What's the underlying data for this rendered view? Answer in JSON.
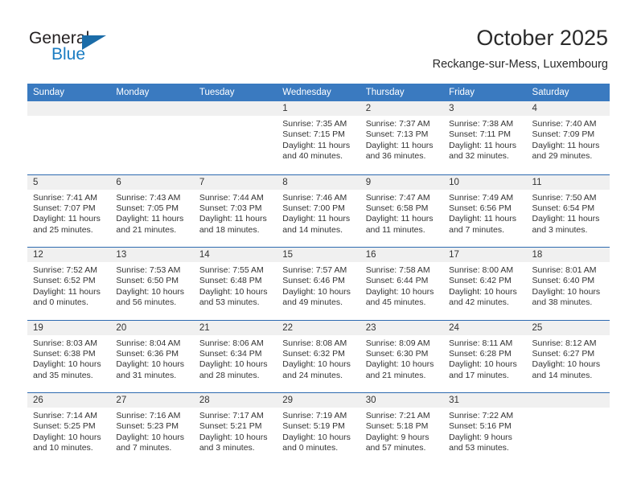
{
  "logo": {
    "word_one": "General",
    "word_two": "Blue",
    "triangle_icon": "triangle-icon",
    "brand_blue": "#1a7cc2",
    "brand_dark": "#231f20"
  },
  "header": {
    "title": "October 2025",
    "subtitle": "Reckange-sur-Mess, Luxembourg",
    "header_bg": "#3a7ac0",
    "row_line": "#2d6ab0",
    "day_band_bg": "#f0f0f0"
  },
  "weekdays": [
    "Sunday",
    "Monday",
    "Tuesday",
    "Wednesday",
    "Thursday",
    "Friday",
    "Saturday"
  ],
  "weeks": [
    [
      {
        "day": "",
        "sunrise": "",
        "sunset": "",
        "daylight_1": "",
        "daylight_2": ""
      },
      {
        "day": "",
        "sunrise": "",
        "sunset": "",
        "daylight_1": "",
        "daylight_2": ""
      },
      {
        "day": "",
        "sunrise": "",
        "sunset": "",
        "daylight_1": "",
        "daylight_2": ""
      },
      {
        "day": "1",
        "sunrise": "Sunrise: 7:35 AM",
        "sunset": "Sunset: 7:15 PM",
        "daylight_1": "Daylight: 11 hours",
        "daylight_2": "and 40 minutes."
      },
      {
        "day": "2",
        "sunrise": "Sunrise: 7:37 AM",
        "sunset": "Sunset: 7:13 PM",
        "daylight_1": "Daylight: 11 hours",
        "daylight_2": "and 36 minutes."
      },
      {
        "day": "3",
        "sunrise": "Sunrise: 7:38 AM",
        "sunset": "Sunset: 7:11 PM",
        "daylight_1": "Daylight: 11 hours",
        "daylight_2": "and 32 minutes."
      },
      {
        "day": "4",
        "sunrise": "Sunrise: 7:40 AM",
        "sunset": "Sunset: 7:09 PM",
        "daylight_1": "Daylight: 11 hours",
        "daylight_2": "and 29 minutes."
      }
    ],
    [
      {
        "day": "5",
        "sunrise": "Sunrise: 7:41 AM",
        "sunset": "Sunset: 7:07 PM",
        "daylight_1": "Daylight: 11 hours",
        "daylight_2": "and 25 minutes."
      },
      {
        "day": "6",
        "sunrise": "Sunrise: 7:43 AM",
        "sunset": "Sunset: 7:05 PM",
        "daylight_1": "Daylight: 11 hours",
        "daylight_2": "and 21 minutes."
      },
      {
        "day": "7",
        "sunrise": "Sunrise: 7:44 AM",
        "sunset": "Sunset: 7:03 PM",
        "daylight_1": "Daylight: 11 hours",
        "daylight_2": "and 18 minutes."
      },
      {
        "day": "8",
        "sunrise": "Sunrise: 7:46 AM",
        "sunset": "Sunset: 7:00 PM",
        "daylight_1": "Daylight: 11 hours",
        "daylight_2": "and 14 minutes."
      },
      {
        "day": "9",
        "sunrise": "Sunrise: 7:47 AM",
        "sunset": "Sunset: 6:58 PM",
        "daylight_1": "Daylight: 11 hours",
        "daylight_2": "and 11 minutes."
      },
      {
        "day": "10",
        "sunrise": "Sunrise: 7:49 AM",
        "sunset": "Sunset: 6:56 PM",
        "daylight_1": "Daylight: 11 hours",
        "daylight_2": "and 7 minutes."
      },
      {
        "day": "11",
        "sunrise": "Sunrise: 7:50 AM",
        "sunset": "Sunset: 6:54 PM",
        "daylight_1": "Daylight: 11 hours",
        "daylight_2": "and 3 minutes."
      }
    ],
    [
      {
        "day": "12",
        "sunrise": "Sunrise: 7:52 AM",
        "sunset": "Sunset: 6:52 PM",
        "daylight_1": "Daylight: 11 hours",
        "daylight_2": "and 0 minutes."
      },
      {
        "day": "13",
        "sunrise": "Sunrise: 7:53 AM",
        "sunset": "Sunset: 6:50 PM",
        "daylight_1": "Daylight: 10 hours",
        "daylight_2": "and 56 minutes."
      },
      {
        "day": "14",
        "sunrise": "Sunrise: 7:55 AM",
        "sunset": "Sunset: 6:48 PM",
        "daylight_1": "Daylight: 10 hours",
        "daylight_2": "and 53 minutes."
      },
      {
        "day": "15",
        "sunrise": "Sunrise: 7:57 AM",
        "sunset": "Sunset: 6:46 PM",
        "daylight_1": "Daylight: 10 hours",
        "daylight_2": "and 49 minutes."
      },
      {
        "day": "16",
        "sunrise": "Sunrise: 7:58 AM",
        "sunset": "Sunset: 6:44 PM",
        "daylight_1": "Daylight: 10 hours",
        "daylight_2": "and 45 minutes."
      },
      {
        "day": "17",
        "sunrise": "Sunrise: 8:00 AM",
        "sunset": "Sunset: 6:42 PM",
        "daylight_1": "Daylight: 10 hours",
        "daylight_2": "and 42 minutes."
      },
      {
        "day": "18",
        "sunrise": "Sunrise: 8:01 AM",
        "sunset": "Sunset: 6:40 PM",
        "daylight_1": "Daylight: 10 hours",
        "daylight_2": "and 38 minutes."
      }
    ],
    [
      {
        "day": "19",
        "sunrise": "Sunrise: 8:03 AM",
        "sunset": "Sunset: 6:38 PM",
        "daylight_1": "Daylight: 10 hours",
        "daylight_2": "and 35 minutes."
      },
      {
        "day": "20",
        "sunrise": "Sunrise: 8:04 AM",
        "sunset": "Sunset: 6:36 PM",
        "daylight_1": "Daylight: 10 hours",
        "daylight_2": "and 31 minutes."
      },
      {
        "day": "21",
        "sunrise": "Sunrise: 8:06 AM",
        "sunset": "Sunset: 6:34 PM",
        "daylight_1": "Daylight: 10 hours",
        "daylight_2": "and 28 minutes."
      },
      {
        "day": "22",
        "sunrise": "Sunrise: 8:08 AM",
        "sunset": "Sunset: 6:32 PM",
        "daylight_1": "Daylight: 10 hours",
        "daylight_2": "and 24 minutes."
      },
      {
        "day": "23",
        "sunrise": "Sunrise: 8:09 AM",
        "sunset": "Sunset: 6:30 PM",
        "daylight_1": "Daylight: 10 hours",
        "daylight_2": "and 21 minutes."
      },
      {
        "day": "24",
        "sunrise": "Sunrise: 8:11 AM",
        "sunset": "Sunset: 6:28 PM",
        "daylight_1": "Daylight: 10 hours",
        "daylight_2": "and 17 minutes."
      },
      {
        "day": "25",
        "sunrise": "Sunrise: 8:12 AM",
        "sunset": "Sunset: 6:27 PM",
        "daylight_1": "Daylight: 10 hours",
        "daylight_2": "and 14 minutes."
      }
    ],
    [
      {
        "day": "26",
        "sunrise": "Sunrise: 7:14 AM",
        "sunset": "Sunset: 5:25 PM",
        "daylight_1": "Daylight: 10 hours",
        "daylight_2": "and 10 minutes."
      },
      {
        "day": "27",
        "sunrise": "Sunrise: 7:16 AM",
        "sunset": "Sunset: 5:23 PM",
        "daylight_1": "Daylight: 10 hours",
        "daylight_2": "and 7 minutes."
      },
      {
        "day": "28",
        "sunrise": "Sunrise: 7:17 AM",
        "sunset": "Sunset: 5:21 PM",
        "daylight_1": "Daylight: 10 hours",
        "daylight_2": "and 3 minutes."
      },
      {
        "day": "29",
        "sunrise": "Sunrise: 7:19 AM",
        "sunset": "Sunset: 5:19 PM",
        "daylight_1": "Daylight: 10 hours",
        "daylight_2": "and 0 minutes."
      },
      {
        "day": "30",
        "sunrise": "Sunrise: 7:21 AM",
        "sunset": "Sunset: 5:18 PM",
        "daylight_1": "Daylight: 9 hours",
        "daylight_2": "and 57 minutes."
      },
      {
        "day": "31",
        "sunrise": "Sunrise: 7:22 AM",
        "sunset": "Sunset: 5:16 PM",
        "daylight_1": "Daylight: 9 hours",
        "daylight_2": "and 53 minutes."
      },
      {
        "day": "",
        "sunrise": "",
        "sunset": "",
        "daylight_1": "",
        "daylight_2": ""
      }
    ]
  ]
}
